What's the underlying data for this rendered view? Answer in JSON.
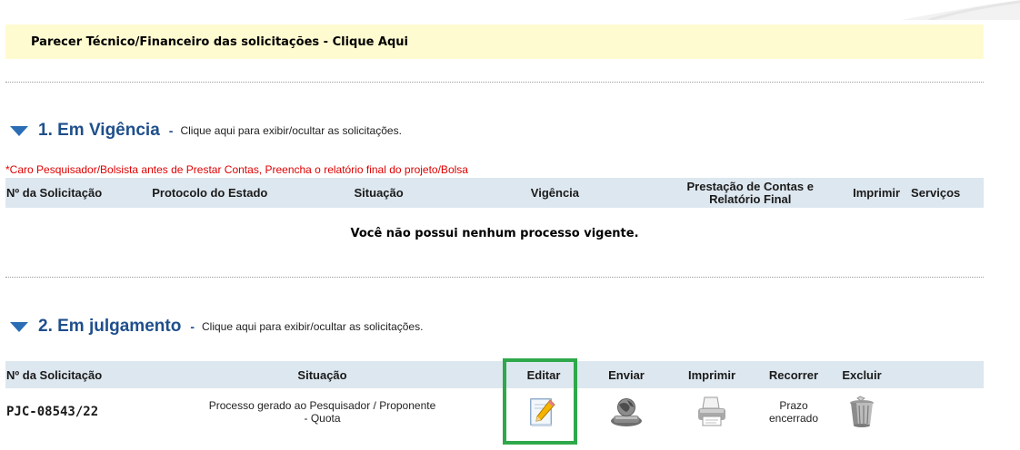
{
  "banner": {
    "text": "Parecer Técnico/Financeiro das solicitações - Clique Aqui"
  },
  "section1": {
    "title": "1. Em Vigência",
    "dash": "-",
    "hint": "Clique aqui para exibir/ocultar as solicitações.",
    "warning": "*Caro Pesquisador/Bolsista antes de Prestar Contas, Preencha o relatório final do projeto/Bolsa",
    "columns": {
      "num": "Nº da Solicitação",
      "protocolo": "Protocolo do Estado",
      "situacao": "Situação",
      "vigencia": "Vigência",
      "prestacao_1": "Prestação de Contas e",
      "prestacao_2": "Relatório Final",
      "imprimir": "Imprimir",
      "servicos": "Serviços"
    },
    "empty_message": "Você não possui nenhum processo vigente."
  },
  "section2": {
    "title": "2. Em julgamento",
    "dash": "-",
    "hint": "Clique aqui para exibir/ocultar as solicitações.",
    "columns": {
      "num": "Nº da Solicitação",
      "situacao": "Situação",
      "editar": "Editar",
      "enviar": "Enviar",
      "imprimir": "Imprimir",
      "recorrer": "Recorrer",
      "excluir": "Excluir"
    },
    "row": {
      "num": "PJC-08543/22",
      "situacao_1": "Processo gerado ao Pesquisador / Proponente",
      "situacao_2": "- Quota",
      "recorrer_1": "Prazo",
      "recorrer_2": "encerrado",
      "icons": [
        "pencil-edit-icon",
        "globe-computer-send-icon",
        "printer-icon",
        "trash-can-icon"
      ]
    }
  },
  "colors": {
    "accent": "#1f4f8c",
    "banner_bg": "#fffbd0",
    "header_bg": "#dde7ef",
    "warning": "#e00000",
    "highlight": "#2ea84a"
  }
}
